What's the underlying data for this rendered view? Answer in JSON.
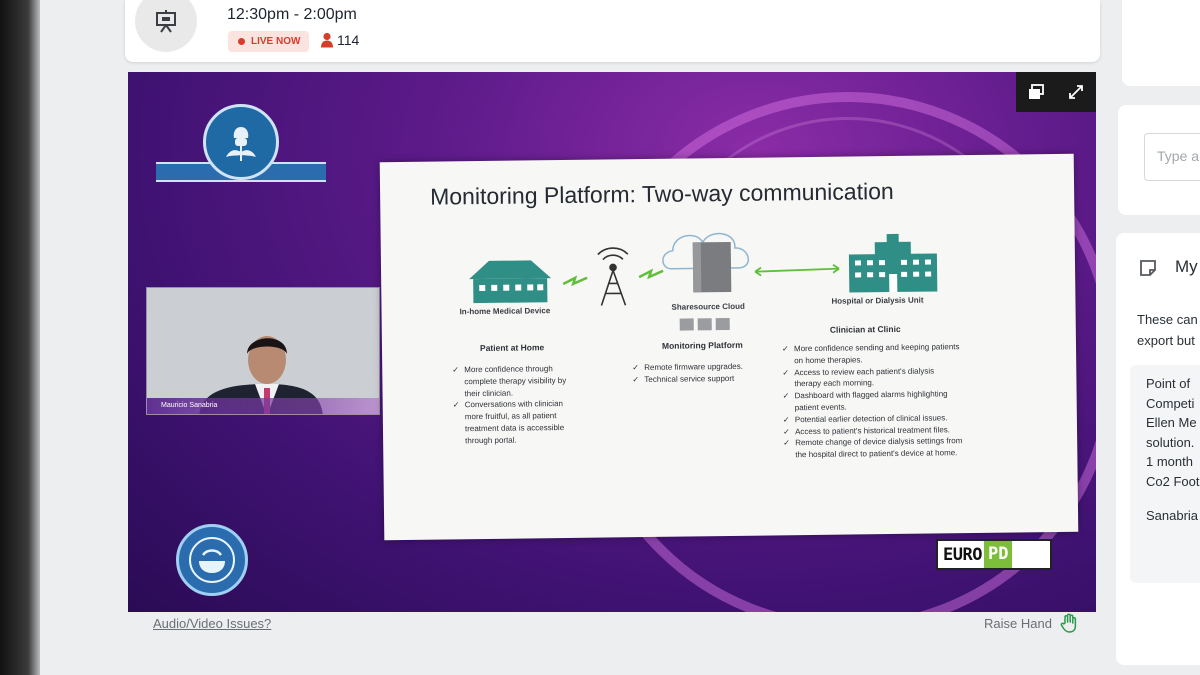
{
  "session": {
    "time": "12:30pm - 2:00pm",
    "live_label": "LIVE NOW",
    "viewer_count": "114"
  },
  "chat": {
    "placeholder": "Type a"
  },
  "notes": {
    "title": "My",
    "description_lines": [
      "These can",
      "export but"
    ],
    "body_lines": [
      "Point of",
      "Competi",
      "Ellen Me",
      "solution.",
      "1 month",
      "Co2 Foot"
    ],
    "author": "Sanabria"
  },
  "video": {
    "speaker_name": "Mauricio Sanabria",
    "sponsor_logo": {
      "part1": "EURO",
      "part2": "PD"
    }
  },
  "slide": {
    "title": "Monitoring Platform: Two-way communication",
    "nodes": {
      "home": "In-home Medical Device",
      "cloud": "Sharesource Cloud",
      "hospital": "Hospital or Dialysis Unit"
    },
    "columns": [
      {
        "heading": "Patient at Home",
        "items": [
          "More confidence through complete therapy visibility by their clinician.",
          "Conversations with clinician more fruitful, as all patient treatment data is accessible through portal."
        ]
      },
      {
        "heading": "Monitoring Platform",
        "items": [
          "Remote firmware upgrades.",
          "Technical service support"
        ]
      },
      {
        "heading": "Clinician at Clinic",
        "items": [
          "More confidence sending and keeping patients on home therapies.",
          "Access to review each patient's dialysis therapy each morning.",
          "Dashboard with flagged alarms highlighting patient events.",
          "Potential earlier detection of clinical issues.",
          "Access to patient's historical treatment files.",
          "Remote change of device dialysis settings from the hospital direct to patient's device at home."
        ]
      }
    ]
  },
  "footer": {
    "audio_link": "Audio/Video Issues?",
    "raise_hand": "Raise Hand"
  },
  "colors": {
    "live_red": "#d2402b",
    "purple_bg": "#5e1b8a",
    "teal_icon": "#2f8f86",
    "europd_green": "#7cbd3a"
  }
}
